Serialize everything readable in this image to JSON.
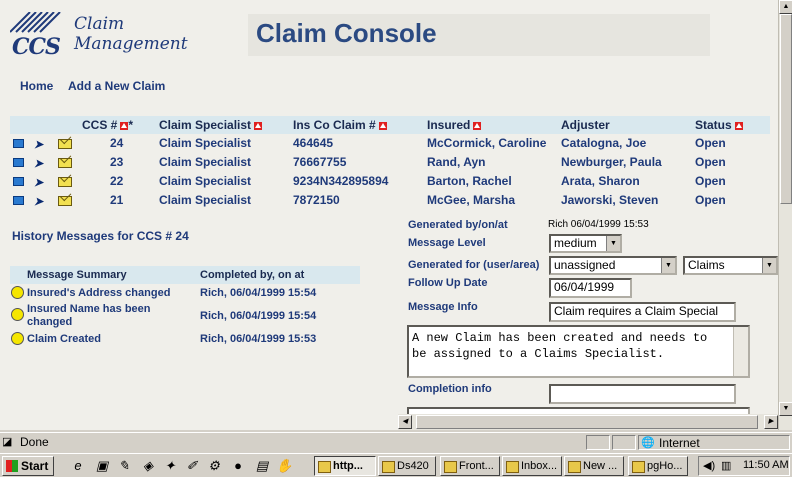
{
  "brand": {
    "logo_mark": "CCS",
    "line1": "Claim",
    "line2": "Management"
  },
  "app_title": "Claim Console",
  "nav": {
    "home": "Home",
    "add_claim": "Add a New Claim"
  },
  "claims_grid": {
    "headers": {
      "ccs": "CCS #",
      "ccs_marker": "*",
      "specialist": "Claim Specialist",
      "ins_claim": "Ins Co Claim #",
      "insured": "Insured",
      "adjuster": "Adjuster",
      "status": "Status"
    },
    "rows": [
      {
        "ccs": "24",
        "specialist": "Claim Specialist",
        "ins_claim": "464645",
        "insured": "McCormick, Caroline",
        "adjuster": "Catalogna, Joe",
        "status": "Open"
      },
      {
        "ccs": "23",
        "specialist": "Claim Specialist",
        "ins_claim": "76667755",
        "insured": "Rand, Ayn",
        "adjuster": "Newburger, Paula",
        "status": "Open"
      },
      {
        "ccs": "22",
        "specialist": "Claim Specialist",
        "ins_claim": "9234N342895894",
        "insured": "Barton, Rachel",
        "adjuster": "Arata, Sharon",
        "status": "Open"
      },
      {
        "ccs": "21",
        "specialist": "Claim Specialist",
        "ins_claim": "7872150",
        "insured": "McGee, Marsha",
        "adjuster": "Jaworski, Steven",
        "status": "Open"
      }
    ]
  },
  "history": {
    "title": "History Messages for CCS # 24",
    "headers": {
      "summary": "Message Summary",
      "completed": "Completed by, on at"
    },
    "rows": [
      {
        "summary": "Insured's Address changed",
        "completed": "Rich, 06/04/1999 15:54"
      },
      {
        "summary": "Insured Name has been changed",
        "completed": "Rich, 06/04/1999 15:54"
      },
      {
        "summary": "Claim Created",
        "completed": "Rich, 06/04/1999 15:53"
      }
    ]
  },
  "detail": {
    "generated_by_label": "Generated by/on/at",
    "generated_by_value": "Rich 06/04/1999 15:53",
    "message_level_label": "Message Level",
    "message_level_value": "medium",
    "generated_for_label": "Generated for (user/area)",
    "generated_for_user": "unassigned",
    "generated_for_area": "Claims",
    "follow_up_label": "Follow Up Date",
    "follow_up_value": "06/04/1999",
    "message_info_label": "Message Info",
    "message_info_value": "Claim requires a Claim Special",
    "message_body": "A new Claim has been created and needs to be assigned to a Claims Specialist.",
    "completion_label": "Completion info",
    "completion_value": ""
  },
  "statusbar": {
    "text": "Done",
    "zone": "Internet"
  },
  "taskbar": {
    "start": "Start",
    "tasks": [
      "http...",
      "Ds420",
      "Front...",
      "Inbox...",
      "New ...",
      "pgHo..."
    ],
    "clock": "11:50 AM"
  },
  "colors": {
    "link": "#1f3a7a",
    "header_bg": "#d9e8ee",
    "title": "#2b4a82"
  }
}
